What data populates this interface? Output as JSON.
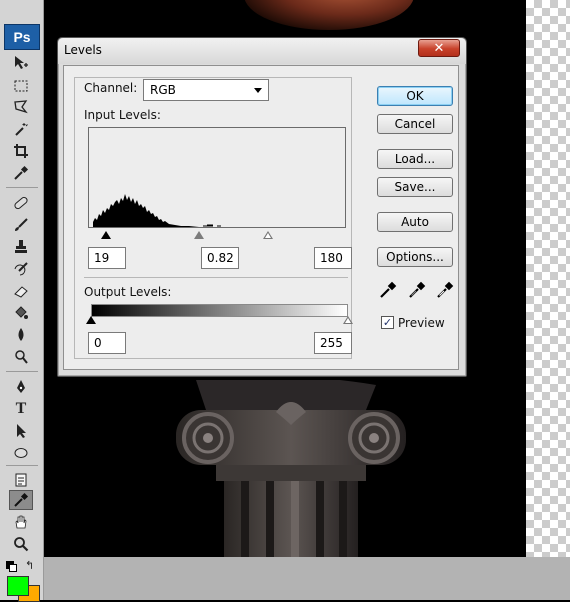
{
  "dialog": {
    "title": "Levels",
    "channel_label": "Channel:",
    "channel_value": "RGB",
    "input_levels_label": "Input Levels:",
    "input_black": "19",
    "input_gamma": "0.82",
    "input_white": "180",
    "output_levels_label": "Output Levels:",
    "output_black": "0",
    "output_white": "255",
    "buttons": {
      "ok": "OK",
      "cancel": "Cancel",
      "load": "Load...",
      "save": "Save...",
      "auto": "Auto",
      "options": "Options..."
    },
    "preview_label": "Preview",
    "preview_checked": true
  },
  "toolbar": {
    "logo": "Ps",
    "tools": [
      "move-icon",
      "marquee-icon",
      "lasso-icon",
      "magic-wand-icon",
      "crop-icon",
      "eyedropper-icon",
      "healing-brush-icon",
      "brush-icon",
      "clone-stamp-icon",
      "history-brush-icon",
      "eraser-icon",
      "paint-bucket-icon",
      "blur-icon",
      "dodge-icon",
      "pen-icon",
      "type-icon",
      "path-selection-icon",
      "ellipse-shape-icon",
      "notes-icon",
      "color-sampler-icon",
      "hand-icon",
      "zoom-icon"
    ],
    "active_tool": "color-sampler-icon",
    "foreground_color": "#00ff00",
    "background_color": "#ffaa00"
  },
  "colors": {
    "ok_button_border": "#3c7fb1",
    "close_button": "#c8412a"
  }
}
